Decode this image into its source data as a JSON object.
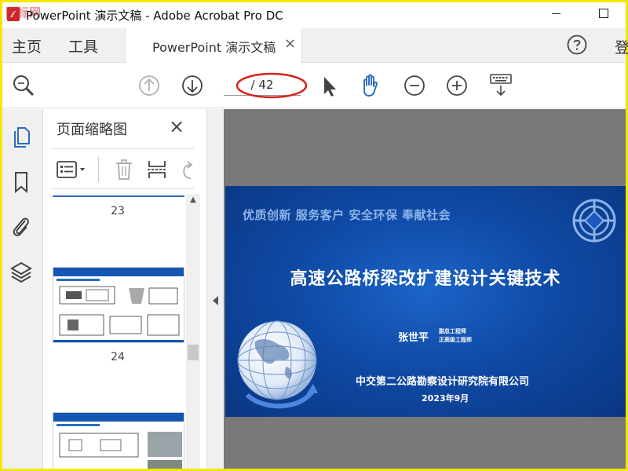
{
  "window": {
    "title": "PowerPoint 演示文稿 - Adobe Acrobat Pro DC",
    "watermark": "图标网"
  },
  "menubar": {
    "home_label": "主页",
    "tools_label": "工具",
    "doc_tab_label": "PowerPoint 演示文稿",
    "doc_tab_close": "×",
    "login_label": "登"
  },
  "toolbar": {
    "page_indicator": "/ 42",
    "icons": [
      "zoom-search-icon",
      "prev-page-icon",
      "next-page-icon",
      "select-cursor-icon",
      "hand-tool-icon",
      "zoom-out-icon",
      "zoom-in-icon",
      "keyboard-down-icon"
    ]
  },
  "leftrail": {
    "icons": [
      "page-thumbnails-icon",
      "bookmark-icon",
      "attachment-icon",
      "layers-icon"
    ]
  },
  "panel": {
    "title": "页面缩略图",
    "close": "×",
    "thumbnails": [
      {
        "page": "23"
      },
      {
        "page": "24"
      }
    ]
  },
  "slide": {
    "slogan": "优质创新 服务客户 安全环保 奉献社会",
    "title": "高速公路桥梁改扩建设计关键技术",
    "presenter": "张世平",
    "presenter_title1": "副总工程师",
    "presenter_title2": "正高级工程师",
    "organization": "中交第二公路勘察设计研究院有限公司",
    "date": "2023年9月"
  },
  "colors": {
    "accent_blue": "#2b6cbf",
    "frame_yellow": "#f3e600",
    "slide_blue": "#0f4aa6",
    "annotation_red": "#d9221c"
  }
}
